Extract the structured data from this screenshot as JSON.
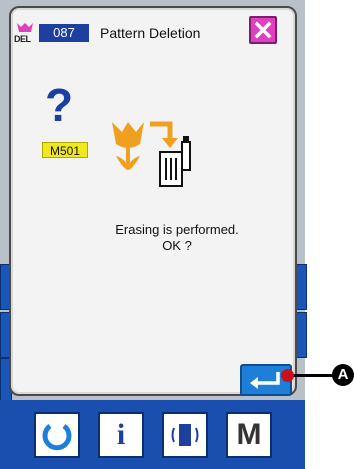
{
  "dialog": {
    "badge_icon_caption": "DEL",
    "pattern_number": "087",
    "title": "Pattern Deletion",
    "message_code": "M501",
    "message_line1": "Erasing is performed.",
    "message_line2": "OK ?"
  },
  "callout": {
    "label": "A"
  },
  "bottom_bar": {
    "info_label": "i",
    "mode_label": "M"
  },
  "colors": {
    "title_number_bg": "#1c3fa0",
    "close_button": "#e040c0",
    "enter_button": "#1e7fd8",
    "message_code_bg": "#f0e81e",
    "bottom_bar": "#1a4fb0",
    "tulip": "#f0a020"
  }
}
